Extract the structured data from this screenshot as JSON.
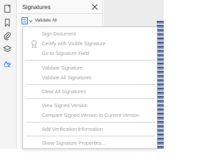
{
  "panel": {
    "title": "Signatures",
    "validate_all": "Validate All"
  },
  "rail": {
    "icons": [
      "pages-icon",
      "bookmark-icon",
      "attachment-icon",
      "layers-icon",
      "signature-icon"
    ]
  },
  "menu": {
    "items": [
      "Sign Document",
      "Certify with Visible Signature",
      "Go to Signature Field",
      "Validate Signature",
      "Validate All Signatures",
      "Clear All Signatures",
      "View Signed Version",
      "Compare Signed Version to Current Version",
      "Add Verification Information",
      "Show Signature Properties..."
    ]
  },
  "colors": {
    "accent": "#1473e6",
    "disabled_text": "#a3a3a3"
  }
}
